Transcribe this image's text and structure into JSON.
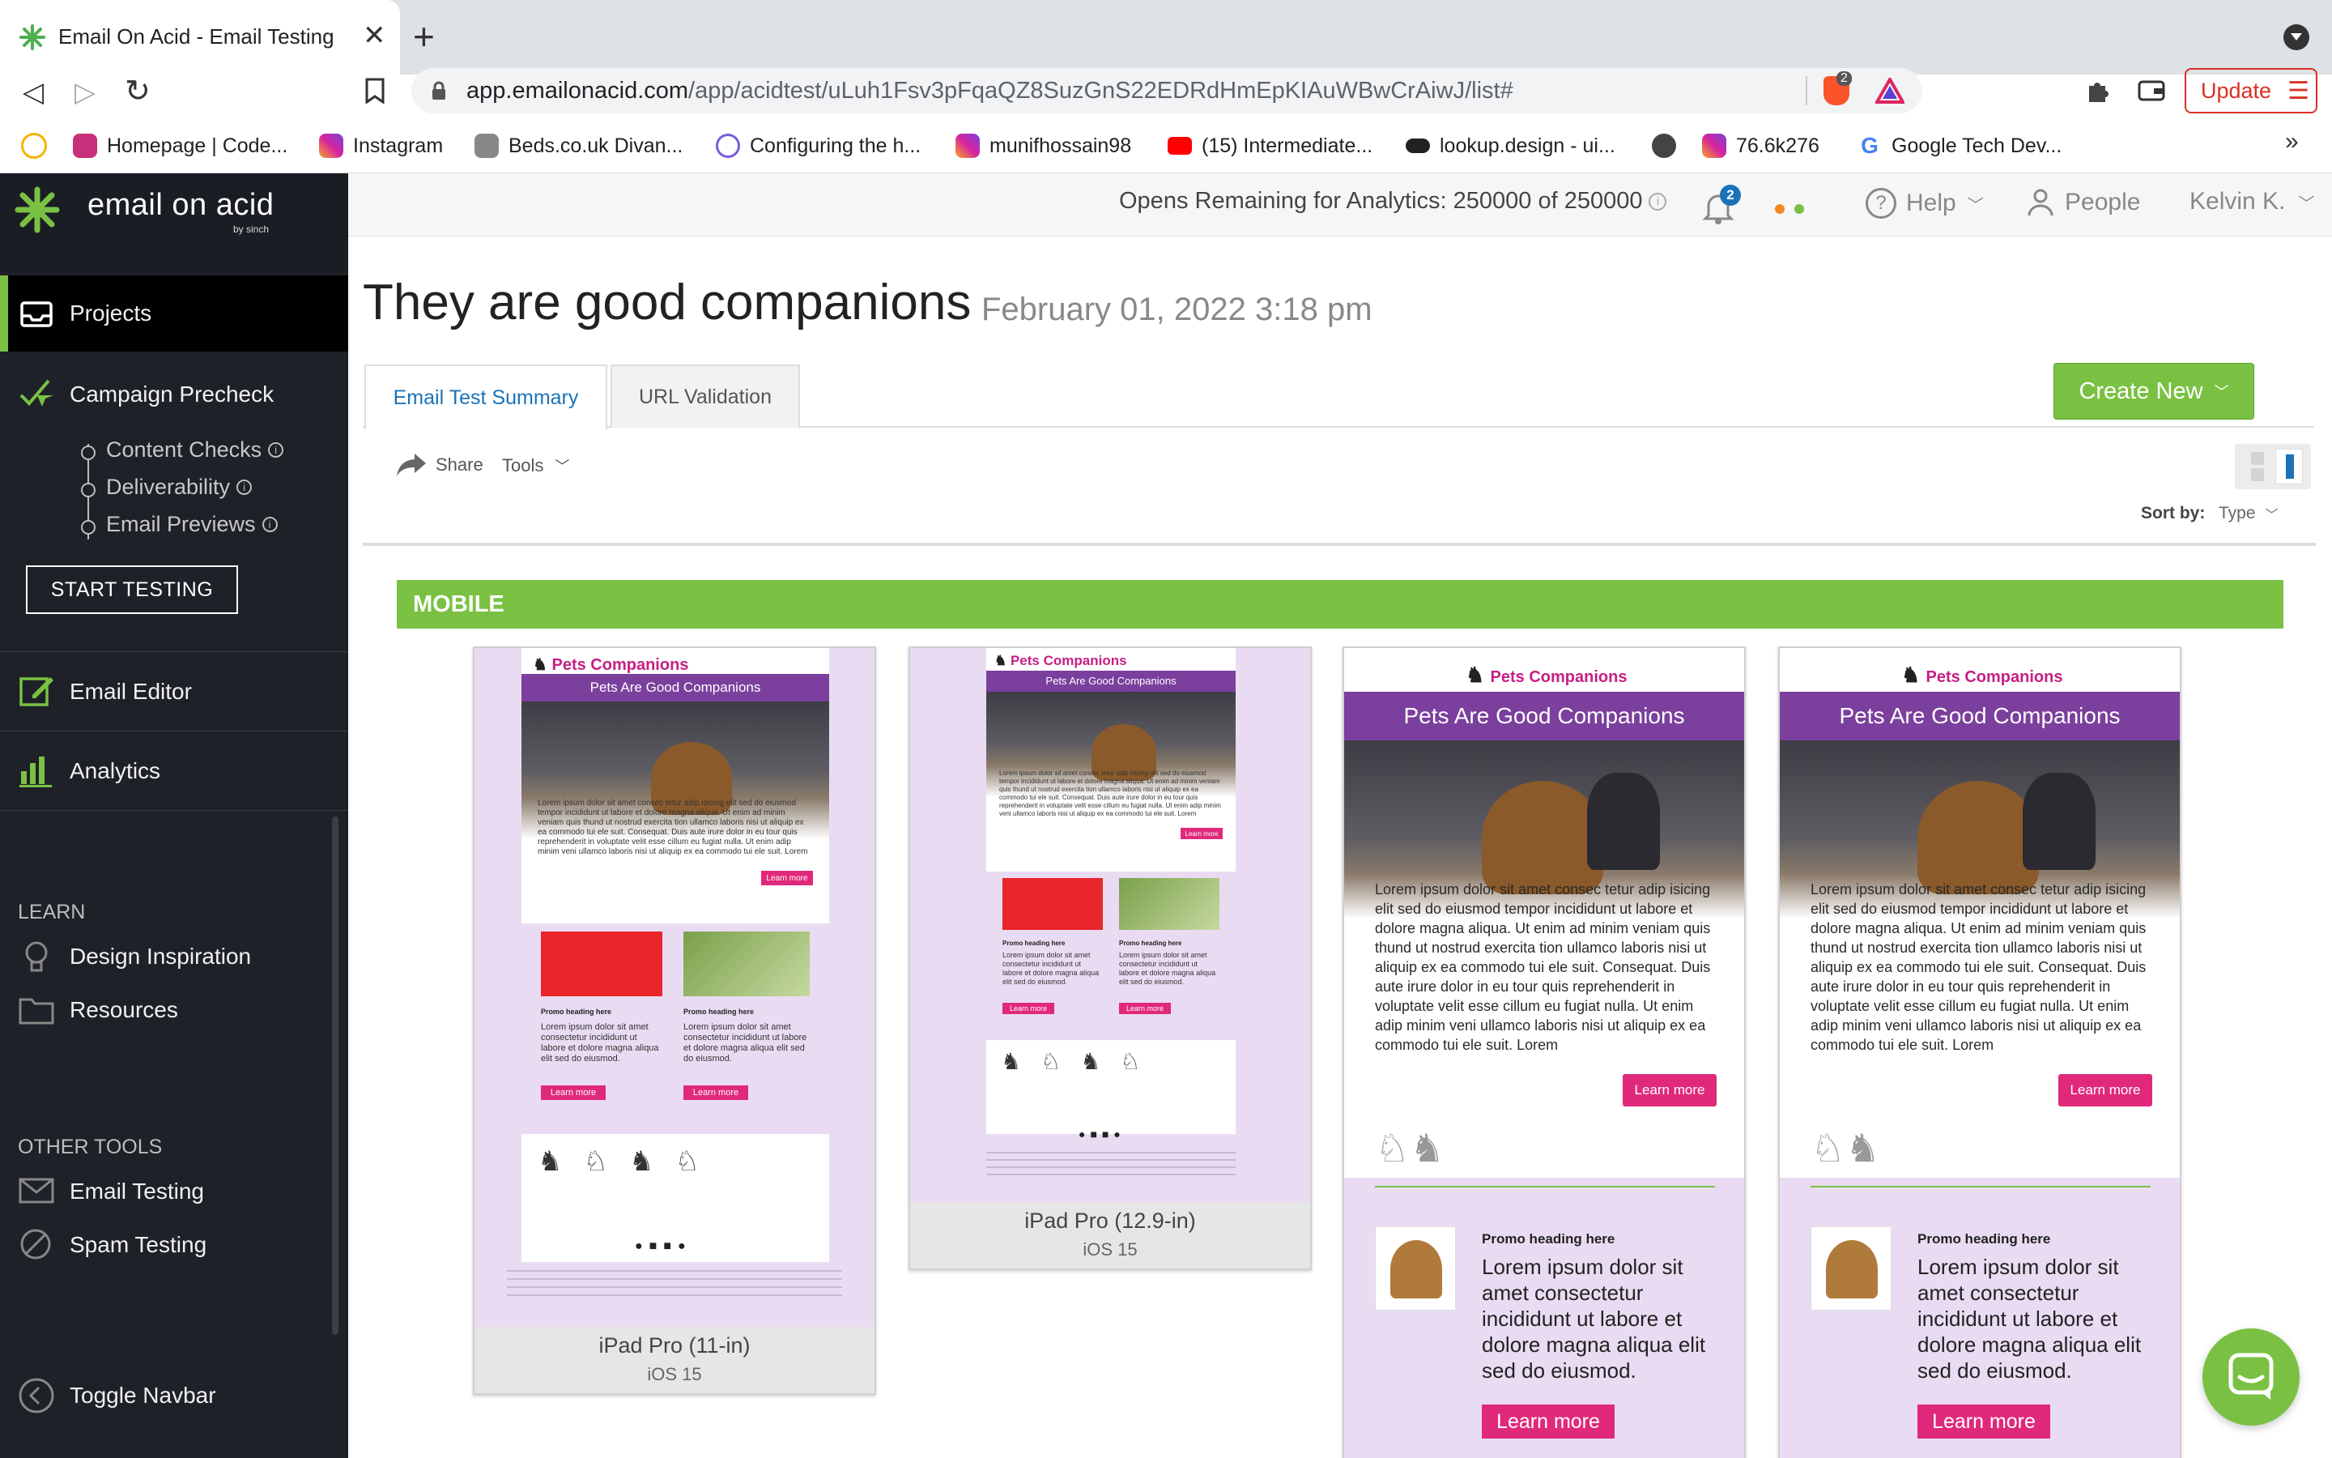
{
  "browser": {
    "tab_title": "Email On Acid - Email Testing",
    "url_domain": "app.emailonacid.com",
    "url_path": "/app/acidtest/uLuh1Fsv3pFqaQZ8SuzGnS22EDRdHmEpKIAuWBwCrAiwJ/list#",
    "update_label": "Update",
    "brave_badge": "2",
    "bookmarks": [
      {
        "label": "Homepage | Code...",
        "icon": "code-icon",
        "color": "#c62f7a"
      },
      {
        "label": "Instagram",
        "icon": "instagram-icon",
        "color": "#d6249f"
      },
      {
        "label": "Beds.co.uk Divan...",
        "icon": "bed-icon",
        "color": "#666666"
      },
      {
        "label": "Configuring the h...",
        "icon": "config-icon",
        "color": "#7a5cd6"
      },
      {
        "label": "munifhossain98",
        "icon": "instagram-icon",
        "color": "#d6249f"
      },
      {
        "label": "(15) Intermediate...",
        "icon": "youtube-icon",
        "color": "#ff0000"
      },
      {
        "label": "lookup.design - ui...",
        "icon": "toggle-icon",
        "color": "#222222"
      },
      {
        "label": "",
        "icon": "globe-icon",
        "color": "#444444"
      },
      {
        "label": "76.6k276",
        "icon": "instagram-icon",
        "color": "#d6249f"
      },
      {
        "label": "Google Tech Dev...",
        "icon": "google-icon",
        "color": "#4285f4"
      }
    ],
    "more_bookmarks": "»"
  },
  "brand": {
    "name": "email on acid",
    "sub": "by sinch",
    "accent": "#7ac143"
  },
  "sidebar": {
    "projects": "Projects",
    "campaign_precheck": "Campaign Precheck",
    "subitems": [
      "Content Checks",
      "Deliverability",
      "Email Previews"
    ],
    "start_testing": "START TESTING",
    "email_editor": "Email Editor",
    "analytics": "Analytics",
    "learn_heading": "LEARN",
    "design_inspiration": "Design Inspiration",
    "resources": "Resources",
    "other_tools_heading": "OTHER TOOLS",
    "email_testing": "Email Testing",
    "spam_testing": "Spam Testing",
    "toggle_navbar": "Toggle Navbar"
  },
  "header": {
    "opens_remaining": "Opens Remaining for Analytics: 250000 of 250000",
    "notif_count": "2",
    "help": "Help",
    "people": "People",
    "user": "Kelvin K."
  },
  "page": {
    "title": "They are good companions",
    "date": "February 01, 2022 3:18 pm",
    "tabs": [
      "Email Test Summary",
      "URL Validation"
    ],
    "create_new": "Create New",
    "share": "Share",
    "tools": "Tools",
    "sort_by_label": "Sort by:",
    "sort_by_value": "Type",
    "section": "MOBILE"
  },
  "email": {
    "brand": "Pets Companions",
    "headline": "Pets Are Good Companions",
    "body": "Lorem ipsum dolor sit amet consec tetur adip isicing elit sed do eiusmod tempor incididunt ut labore et dolore magna aliqua. Ut enim ad minim veniam quis thund ut nostrud exercita tion ullamco laboris nisi ut aliquip ex ea commodo tui ele suit. Consequat. Duis aute irure dolor in eu tour quis reprehenderit in voluptate velit esse cillum eu fugiat nulla. Ut enim adip minim veni ullamco laboris nisi ut aliquip ex ea commodo tui ele suit. Lorem",
    "learn_more": "Learn more",
    "promo_heading": "Promo heading here",
    "promo_text": "Lorem ipsum dolor sit amet consectetur incididunt ut labore et dolore magna aliqua elit sed do eiusmod."
  },
  "previews": [
    {
      "device": "iPad Pro (11-in)",
      "os": "iOS 15"
    },
    {
      "device": "iPad Pro (12.9-in)",
      "os": "iOS 15"
    },
    {
      "device": "",
      "os": ""
    },
    {
      "device": "",
      "os": ""
    }
  ],
  "colors": {
    "green": "#7ac143",
    "purple": "#7b3f9d",
    "pink": "#e0297a",
    "lavender": "#e9dcf2",
    "link_blue": "#1a73b8"
  }
}
